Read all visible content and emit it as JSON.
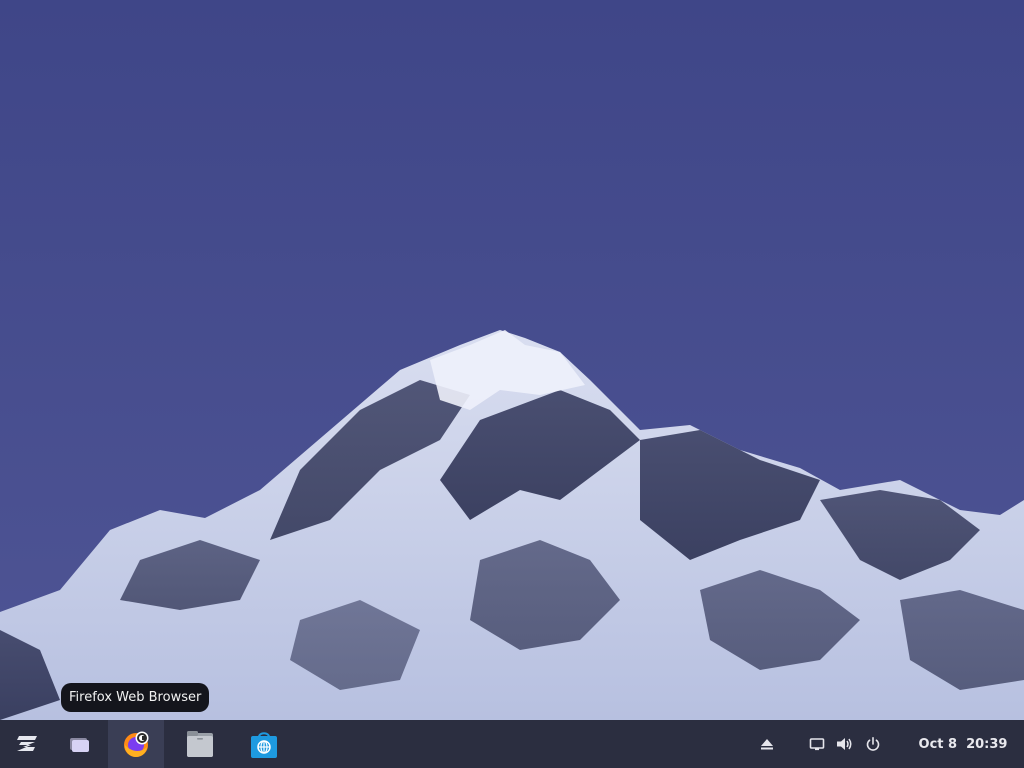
{
  "tooltip": {
    "text": "Firefox Web Browser"
  },
  "taskbar": {
    "apps": [
      {
        "icon": "zorin-menu-icon"
      },
      {
        "icon": "workspaces-icon"
      },
      {
        "icon": "firefox-icon"
      },
      {
        "icon": "files-folder-icon"
      },
      {
        "icon": "software-store-icon"
      }
    ],
    "tray": [
      {
        "icon": "eject-icon"
      },
      {
        "icon": "display-icon"
      },
      {
        "icon": "volume-icon"
      },
      {
        "icon": "power-icon"
      }
    ],
    "clock": {
      "date": "Oct 8",
      "time": "20:39"
    }
  },
  "colors": {
    "sky": "#4a5090",
    "taskbar": "#2b2e40",
    "tooltip": "#14151c",
    "store_blue": "#1e9ae0"
  }
}
